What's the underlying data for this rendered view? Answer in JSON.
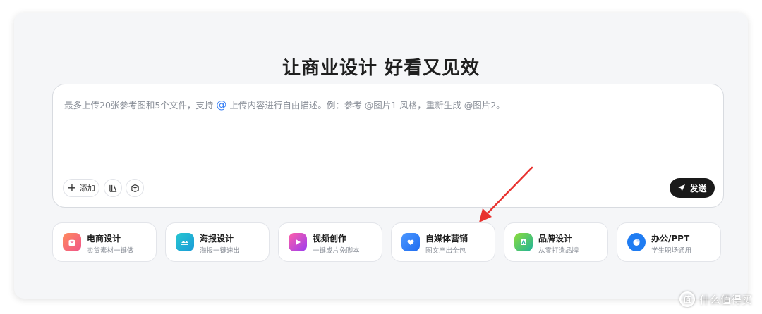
{
  "headline": "让商业设计 好看又见效",
  "composer": {
    "placeholder_before": "最多上传20张参考图和5个文件，支持 ",
    "placeholder_at": "@",
    "placeholder_after": " 上传内容进行自由描述。例：参考 @图片1 风格，重新生成 @图片2。",
    "add_label": "添加",
    "library_icon": "library-icon",
    "cube_icon": "cube-icon",
    "send_label": "发送"
  },
  "shortcuts": [
    {
      "title": "电商设计",
      "subtitle": "卖货素材一键做",
      "icon": "shopping-bag-icon",
      "color": "#f26a4f"
    },
    {
      "title": "海报设计",
      "subtitle": "海报一键速出",
      "icon": "poster-icon",
      "color": "#19b8c8"
    },
    {
      "title": "视频创作",
      "subtitle": "一键成片免脚本",
      "icon": "video-play-icon",
      "color": "#c245e0"
    },
    {
      "title": "自媒体营销",
      "subtitle": "图文产出全包",
      "icon": "heart-chat-icon",
      "color": "#2f7df6"
    },
    {
      "title": "品牌设计",
      "subtitle": "从零打造品牌",
      "icon": "brand-icon",
      "color": "#3ec27a"
    },
    {
      "title": "办公/PPT",
      "subtitle": "学生职场通用",
      "icon": "pie-chart-icon",
      "color": "#1f7cf2"
    }
  ],
  "annotation": {
    "color": "#e8322f"
  },
  "watermark": {
    "text": "什么值得买",
    "logo_char": "值"
  }
}
